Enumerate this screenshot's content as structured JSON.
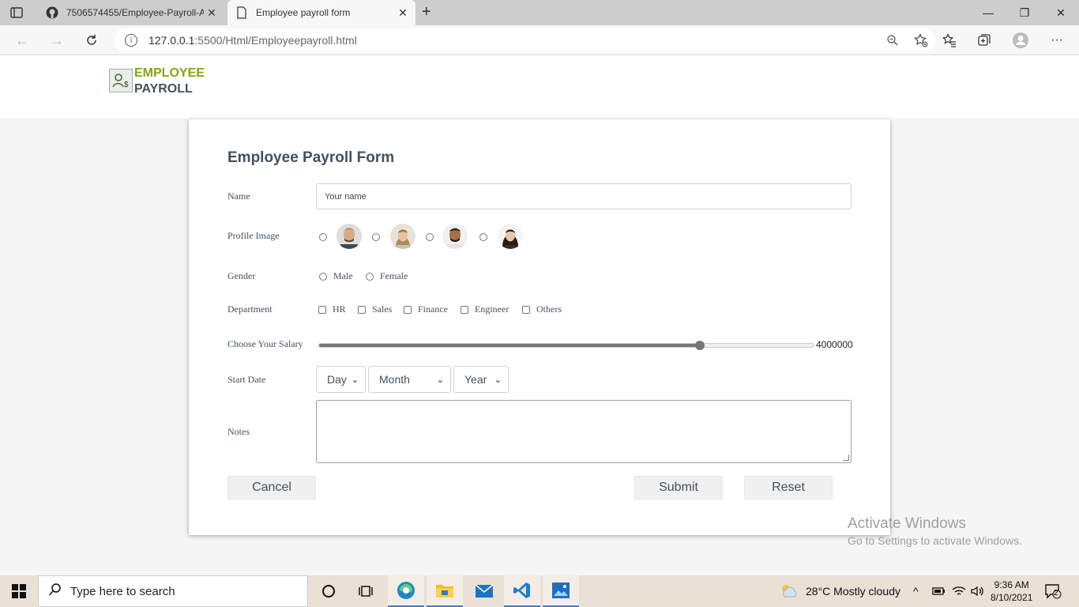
{
  "browser": {
    "tabs": [
      {
        "title": "7506574455/Employee-Payroll-A",
        "icon": "github-icon",
        "close": "✕"
      },
      {
        "title": "Employee payroll form",
        "icon": "page-icon",
        "close": "✕"
      }
    ],
    "new_tab": "+",
    "window_controls": {
      "minimize": "—",
      "restore": "❐",
      "close": "✕"
    },
    "url_host": "127.0.0.1",
    "url_path": ":5500/Html/Employeepayroll.html"
  },
  "header": {
    "logo_line1": "EMPLOYEE",
    "logo_line2": "PAYROLL"
  },
  "form": {
    "title": "Employee Payroll Form",
    "name": {
      "label": "Name",
      "placeholder": "Your name"
    },
    "profile": {
      "label": "Profile Image",
      "options": [
        "avatar-1",
        "avatar-2",
        "avatar-3",
        "avatar-4"
      ]
    },
    "gender": {
      "label": "Gender",
      "options": [
        "Male",
        "Female"
      ]
    },
    "department": {
      "label": "Department",
      "options": [
        "HR",
        "Sales",
        "Finance",
        "Engineer",
        "Others"
      ]
    },
    "salary": {
      "label": "Choose Your Salary",
      "value": "4000000",
      "fraction": 0.77
    },
    "start_date": {
      "label": "Start Date",
      "day": "Day",
      "month": "Month",
      "year": "Year"
    },
    "notes": {
      "label": "Notes"
    },
    "buttons": {
      "cancel": "Cancel",
      "submit": "Submit",
      "reset": "Reset"
    }
  },
  "watermark": {
    "line1": "Activate Windows",
    "line2": "Go to Settings to activate Windows."
  },
  "taskbar": {
    "search_placeholder": "Type here to search",
    "weather": "28°C  Mostly cloudy",
    "time": "9:36 AM",
    "date": "8/10/2021",
    "notifications": "2"
  }
}
